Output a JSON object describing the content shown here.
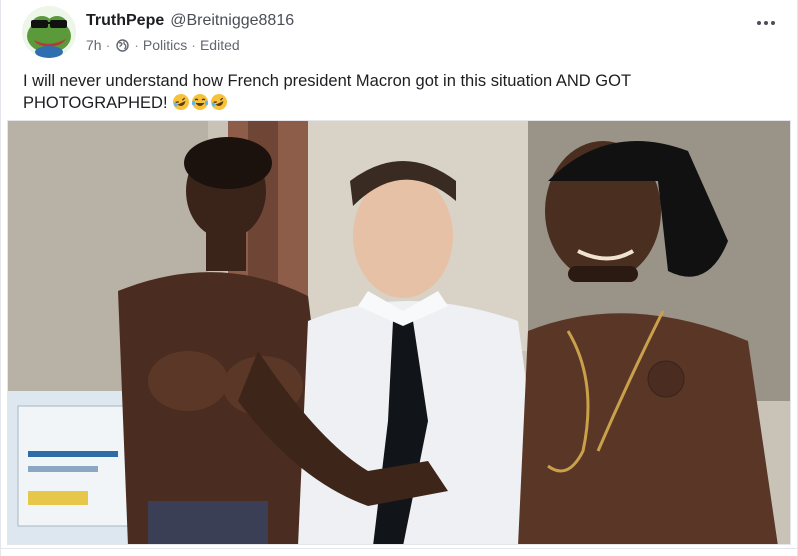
{
  "post": {
    "author": {
      "display_name": "TruthPepe",
      "handle": "@Breitnigge8816",
      "avatar_icon": "frog-with-sunglasses-avatar"
    },
    "meta": {
      "time": "7h",
      "separator": "·",
      "visibility_icon": "globe-icon",
      "category": "Politics",
      "edited_label": "Edited"
    },
    "more_icon": "more-options-icon",
    "text": "I will never understand how French president Macron got in this situation AND GOT PHOTOGRAPHED!",
    "emojis": [
      "rolling-on-the-floor-laughing",
      "face-with-tears-of-joy",
      "rolling-on-the-floor-laughing"
    ],
    "media": {
      "type": "photo",
      "description_icon": "photo-of-three-men-icon"
    }
  },
  "colors": {
    "name": "#1c1e21",
    "secondary": "#606770",
    "border": "#e4e6eb"
  }
}
